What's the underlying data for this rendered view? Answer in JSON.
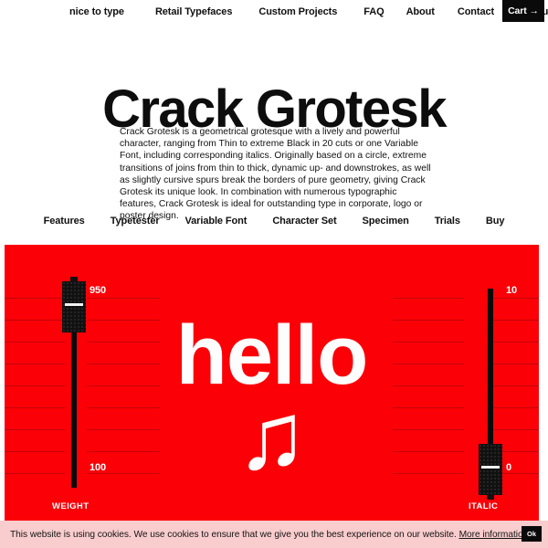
{
  "topnav": {
    "brand": "nice to type",
    "items": [
      {
        "label": "Retail Typefaces"
      },
      {
        "label": "Custom Projects"
      },
      {
        "label": "FAQ"
      },
      {
        "label": "About"
      },
      {
        "label": "Contact"
      },
      {
        "label": "Account"
      }
    ],
    "cart_label": "Cart →"
  },
  "hero": {
    "title": "Crack Grotesk",
    "description": "Crack Grotesk is a geometrical grotesque with a lively and powerful character, ranging from Thin to extreme Black in 20 cuts or one Variable Font, including corresponding italics. Originally based on a circle, extreme transitions of joins from thin to thick, dynamic up- and downstrokes, as well as slightly cursive spurs break the borders of pure geometry, giving Crack Grotesk its unique look. In combination with numerous typographic features, Crack Grotesk is ideal for outstanding type in corporate, logo or poster design."
  },
  "section_links": [
    {
      "label": "Features"
    },
    {
      "label": "Typetester"
    },
    {
      "label": "Variable Font"
    },
    {
      "label": "Character Set"
    },
    {
      "label": "Specimen"
    },
    {
      "label": "Trials"
    },
    {
      "label": "Buy"
    }
  ],
  "typetester": {
    "background_color": "#fb0007",
    "sample_text": "hello",
    "sample_glyph": "♫",
    "weight_slider": {
      "label": "WEIGHT",
      "max_value": "950",
      "min_value": "100",
      "current": "950"
    },
    "italic_slider": {
      "label": "ITALIC",
      "max_value": "10",
      "min_value": "0",
      "current": "0"
    }
  },
  "cookie_banner": {
    "text": "This website is using cookies. We use cookies to ensure that we give you the best experience on our website. ",
    "link_label": "More information",
    "ok_label": "Ok",
    "background_color": "#f9cccd"
  }
}
